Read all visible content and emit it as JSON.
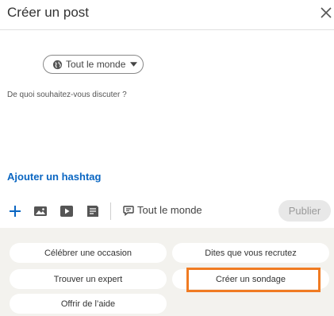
{
  "header": {
    "title": "Créer un post"
  },
  "audience": {
    "label": "Tout le monde"
  },
  "compose": {
    "placeholder": "De quoi souhaitez-vous discuter ?"
  },
  "hashtag": {
    "label": "Ajouter un hashtag"
  },
  "toolbar": {
    "comment_scope": "Tout le monde",
    "publish_label": "Publier"
  },
  "actions": {
    "celebrate": "Célébrer une occasion",
    "hiring": "Dites que vous recrutez",
    "find_expert": "Trouver un expert",
    "poll": "Créer un sondage",
    "offer_help": "Offrir de l’aide"
  },
  "colors": {
    "accent": "#0a66c2",
    "highlight": "#f07b22"
  }
}
